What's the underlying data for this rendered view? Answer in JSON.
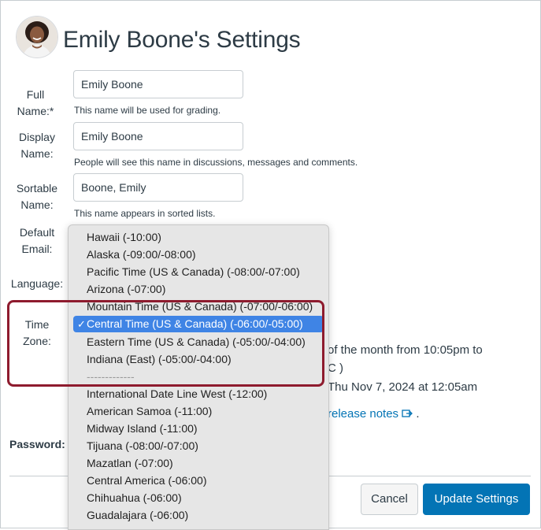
{
  "page": {
    "title": "Emily Boone's Settings"
  },
  "form": {
    "full_name": {
      "label": "Full Name:*",
      "value": "Emily Boone",
      "hint": "This name will be used for grading."
    },
    "display_name": {
      "label_line1": "Display",
      "label_line2": "Name:",
      "value": "Emily Boone",
      "hint": "People will see this name in discussions, messages and comments."
    },
    "sortable_name": {
      "label_line1": "Sortable",
      "label_line2": "Name:",
      "value": "Boone, Emily",
      "hint": "This name appears in sorted lists."
    },
    "default_email": {
      "label_line1": "Default",
      "label_line2": "Email:"
    },
    "language": {
      "label": "Language:"
    },
    "time_zone": {
      "label": "Time Zone:"
    },
    "password": {
      "label": "Password:"
    }
  },
  "background_text": {
    "line1": "of the month from 10:05pm to",
    "line2": "C )",
    "line3": "Thu Nov 7, 2024 at 12:05am",
    "release_notes": "release notes",
    "period": "."
  },
  "timezone_dropdown": {
    "selected": "Central Time (US & Canada) (-06:00/-05:00)",
    "options": [
      "Hawaii (-10:00)",
      "Alaska (-09:00/-08:00)",
      "Pacific Time (US & Canada) (-08:00/-07:00)",
      "Arizona (-07:00)",
      "Mountain Time (US & Canada) (-07:00/-06:00)",
      "Central Time (US & Canada) (-06:00/-05:00)",
      "Eastern Time (US & Canada) (-05:00/-04:00)",
      "Indiana (East) (-05:00/-04:00)",
      "-------------",
      "International Date Line West (-12:00)",
      "American Samoa (-11:00)",
      "Midway Island (-11:00)",
      "Tijuana (-08:00/-07:00)",
      "Mazatlan (-07:00)",
      "Central America (-06:00)",
      "Chihuahua (-06:00)",
      "Guadalajara (-06:00)"
    ]
  },
  "buttons": {
    "cancel": "Cancel",
    "update": "Update Settings"
  },
  "icons": {
    "avatar": "user-avatar",
    "check": "checkmark-icon",
    "external": "external-link-icon"
  },
  "colors": {
    "accent": "#0374b5",
    "highlight_border": "#8e1b2e",
    "selected_option": "#3f84e5"
  }
}
